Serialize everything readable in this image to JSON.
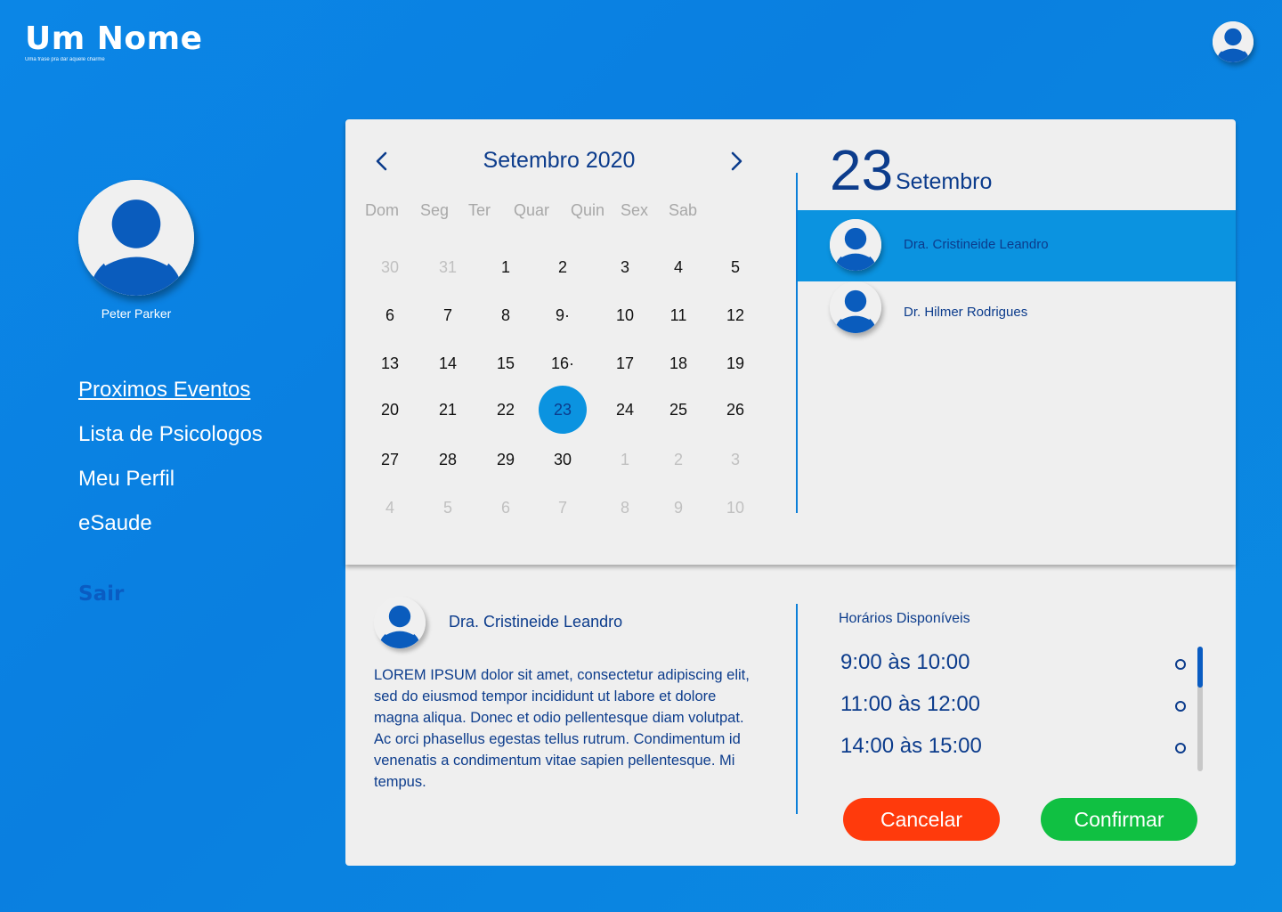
{
  "brand": {
    "title": "Um Nome",
    "tagline": "Uma frase pra dar aquele charme"
  },
  "sidebar": {
    "user_name": "Peter Parker",
    "items": [
      {
        "label": "Proximos Eventos",
        "active": true
      },
      {
        "label": "Lista de Psicologos",
        "active": false
      },
      {
        "label": "Meu Perfil",
        "active": false
      },
      {
        "label": "eSaude",
        "active": false
      }
    ],
    "logout": "Sair"
  },
  "calendar": {
    "month_label": "Setembro 2020",
    "weekdays": [
      "Dom",
      "Seg",
      "Ter",
      "Quar",
      "Quin",
      "Sex",
      "Sab"
    ],
    "weeks": [
      [
        {
          "d": "30",
          "m": true
        },
        {
          "d": "31",
          "m": true
        },
        {
          "d": "1"
        },
        {
          "d": "2"
        },
        {
          "d": "3"
        },
        {
          "d": "4"
        },
        {
          "d": "5"
        }
      ],
      [
        {
          "d": "6"
        },
        {
          "d": "7"
        },
        {
          "d": "8"
        },
        {
          "d": "9·"
        },
        {
          "d": "10"
        },
        {
          "d": "11"
        },
        {
          "d": "12"
        }
      ],
      [
        {
          "d": "13"
        },
        {
          "d": "14"
        },
        {
          "d": "15"
        },
        {
          "d": "16·"
        },
        {
          "d": "17"
        },
        {
          "d": "18"
        },
        {
          "d": "19"
        }
      ],
      [
        {
          "d": "20"
        },
        {
          "d": "21"
        },
        {
          "d": "22"
        },
        {
          "d": "23",
          "s": true
        },
        {
          "d": "24"
        },
        {
          "d": "25"
        },
        {
          "d": "26"
        }
      ],
      [
        {
          "d": "27"
        },
        {
          "d": "28"
        },
        {
          "d": "29"
        },
        {
          "d": "30"
        },
        {
          "d": "1",
          "m": true
        },
        {
          "d": "2",
          "m": true
        },
        {
          "d": "3",
          "m": true
        }
      ],
      [
        {
          "d": "4",
          "m": true
        },
        {
          "d": "5",
          "m": true
        },
        {
          "d": "6",
          "m": true
        },
        {
          "d": "7",
          "m": true
        },
        {
          "d": "8",
          "m": true
        },
        {
          "d": "9",
          "m": true
        },
        {
          "d": "10",
          "m": true
        }
      ]
    ]
  },
  "selected_date": {
    "day": "23",
    "month": "Setembro"
  },
  "psychologists": [
    {
      "name": "Dra. Cristineide Leandro",
      "active": true
    },
    {
      "name": "Dr. Hilmer Rodrigues",
      "active": false
    }
  ],
  "detail": {
    "name": "Dra. Cristineide Leandro",
    "bio": "LOREM IPSUM dolor sit amet, consectetur adipiscing elit, sed do eiusmod tempor incididunt ut labore et dolore magna aliqua. Donec et odio pellentesque diam volutpat. Ac orci phasellus egestas tellus rutrum. Condimentum id venenatis a condimentum vitae sapien pellentesque. Mi tempus."
  },
  "slots": {
    "title": "Horários Disponíveis",
    "items": [
      "9:00 às 10:00",
      "11:00 às 12:00",
      "14:00 às 15:00"
    ]
  },
  "actions": {
    "cancel": "Cancelar",
    "confirm": "Confirmar"
  },
  "colors": {
    "accent": "#0b93e0",
    "text_dark": "#0c3c8c",
    "cancel": "#ff3a0c",
    "confirm": "#10c042"
  }
}
